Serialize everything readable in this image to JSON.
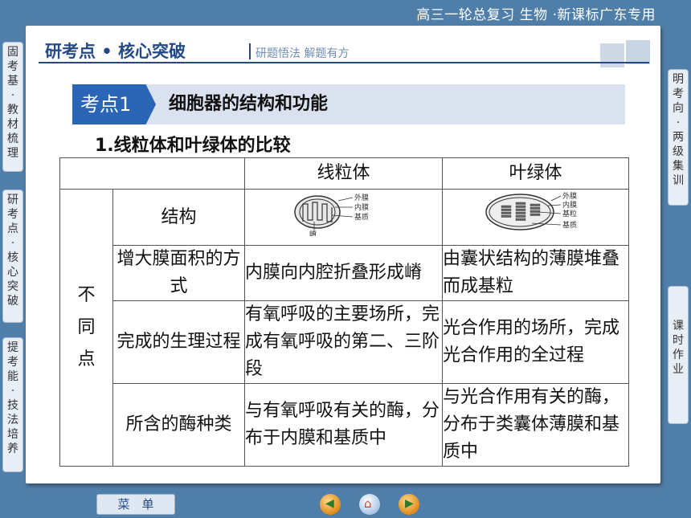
{
  "top_title": "高三一轮总复习 生物 ·新课标广东专用",
  "header": {
    "main": "研考点 • 核心突破",
    "sub": "研题悟法  解题有方"
  },
  "kaodian": {
    "tag": "考点1",
    "title": "细胞器的结构和功能"
  },
  "section_title": "1.线粒体和叶绿体的比较",
  "table": {
    "col_headers": [
      "线粒体",
      "叶绿体"
    ],
    "side_label": "不同点",
    "rows": [
      {
        "label": "结构",
        "mito": "",
        "chloro": ""
      },
      {
        "label": "增大膜面积的方式",
        "mito": "内膜向内腔折叠形成嵴",
        "chloro": "由囊状结构的薄膜堆叠而成基粒"
      },
      {
        "label": "完成的生理过程",
        "mito": "有氧呼吸的主要场所，完成有氧呼吸的第二、三阶段",
        "chloro": "光合作用的场所，完成光合作用的全过程"
      },
      {
        "label": "所含的酶种类",
        "mito": "与有氧呼吸有关的酶，分布于内膜和基质中",
        "chloro": "与光合作用有关的酶，分布于类囊体薄膜和基质中"
      }
    ],
    "mito_diagram_labels": [
      "外膜",
      "内膜",
      "基质",
      "嵴"
    ],
    "chloro_diagram_labels": [
      "外膜",
      "内膜",
      "基粒",
      "基质"
    ]
  },
  "left_tabs": [
    "固考基·教材梳理",
    "研考点·核心突破",
    "提考能·技法培养"
  ],
  "right_tabs": [
    "明考向·两级集训",
    "课时作业"
  ],
  "bottom_menu": "菜　单",
  "colors": {
    "background": "#4f7fa9",
    "header_text": "#234a86",
    "kd_tag": "#2a66b5",
    "kd_box": "#d9e2ee"
  }
}
